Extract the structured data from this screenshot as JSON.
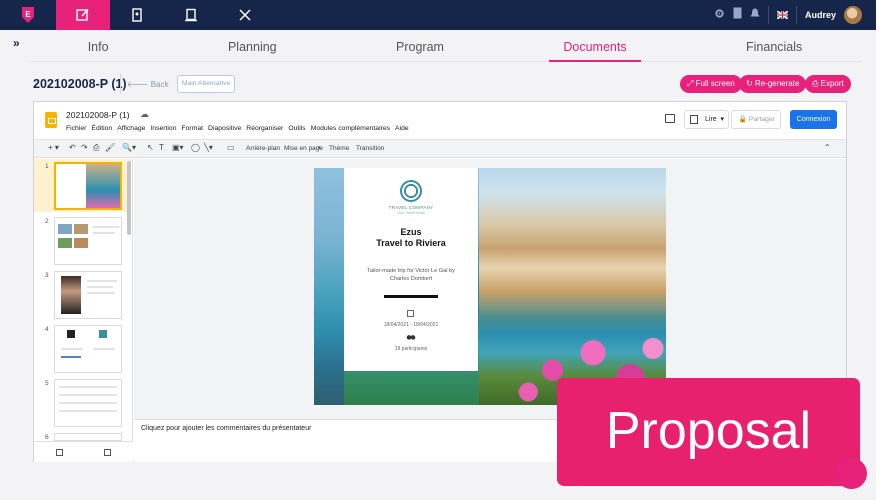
{
  "nav": {
    "user_name": "Audrey",
    "flag": "uk-flag",
    "active_tab": "edit"
  },
  "tabs": {
    "info": "Info",
    "planning": "Planning",
    "program": "Program",
    "documents": "Documents",
    "financials": "Financials"
  },
  "toolbar": {
    "doc_code": "202102008-P (1)",
    "back_label": "Back",
    "alt_label": "Main Alternative",
    "fullscreen_label": "Full screen",
    "regenerate_label": "Re-generate",
    "export_label": "Export"
  },
  "gslides": {
    "title": "202102008-P (1)",
    "menu": [
      "Fichier",
      "Édition",
      "Affichage",
      "Insertion",
      "Format",
      "Diapositive",
      "Réorganiser",
      "Outils",
      "Modules complémentaires",
      "Aide"
    ],
    "lire_label": "Lire",
    "partager_label": "Partager",
    "connexion_label": "Connexion",
    "tools": {
      "background": "Arrière-plan",
      "layout": "Mise en page",
      "theme": "Thème",
      "transition": "Transition"
    },
    "slide_numbers": [
      "1",
      "2",
      "3",
      "4",
      "5",
      "6"
    ],
    "notes_placeholder": "Cliquez pour ajouter les commentaires du présentateur"
  },
  "slide": {
    "company": "TRAVEL COMPANY",
    "tagline": "Your Travel Guide",
    "title1": "Ezus",
    "title2": "Travel to Riviera",
    "subtitle": "Tailor-made trip for Victor Le Gal by Charles Dombert",
    "dates": "18/04/2021 - 18/04/2021",
    "participants": "18 participants"
  },
  "badge": {
    "label": "Proposal"
  },
  "colors": {
    "navy": "#16264b",
    "pink": "#e8217a",
    "blue": "#1a73e8"
  }
}
